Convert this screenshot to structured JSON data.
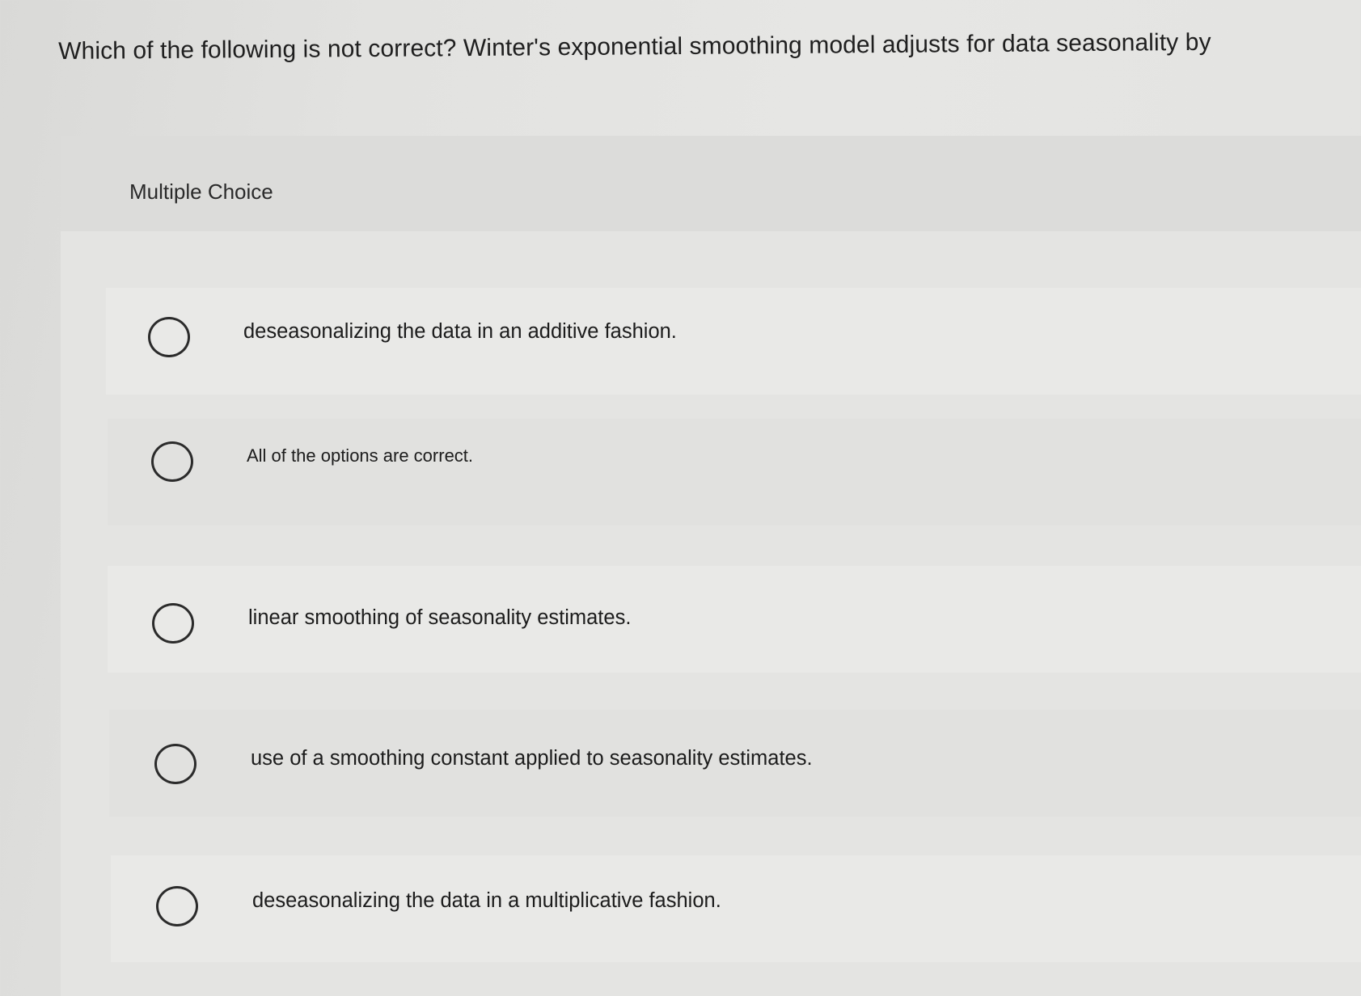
{
  "question": {
    "text": "Which of the following is not correct? Winter's exponential smoothing model adjusts for data seasonality by"
  },
  "multiple_choice": {
    "label": "Multiple Choice",
    "options": [
      {
        "label": "deseasonalizing the data in an additive fashion.",
        "selected": false
      },
      {
        "label": "All of the options are correct.",
        "selected": false
      },
      {
        "label": "linear smoothing of seasonality estimates.",
        "selected": false
      },
      {
        "label": "use of a smoothing constant applied to seasonality estimates.",
        "selected": false
      },
      {
        "label": "deseasonalizing the data in a multiplicative fashion.",
        "selected": false
      }
    ]
  }
}
